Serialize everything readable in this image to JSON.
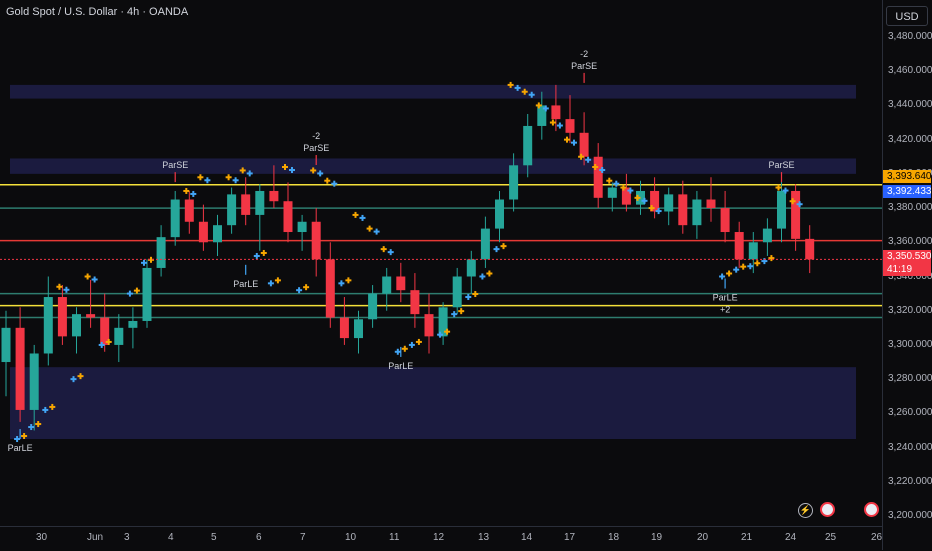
{
  "header": {
    "title": "Gold Spot / U.S. Dollar · 4h · OANDA",
    "currency": "USD"
  },
  "price_axis": {
    "ticks": [
      "3,480.000",
      "3,460.000",
      "3,440.000",
      "3,420.000",
      "3,400.000",
      "3,380.000",
      "3,360.000",
      "3,340.000",
      "3,320.000",
      "3,300.000",
      "3,280.000",
      "3,260.000",
      "3,240.000",
      "3,220.000",
      "3,200.000"
    ],
    "labels": {
      "resistance": "3,393.640",
      "marker": "3,392.433",
      "last_price": "3,350.530",
      "countdown": "41:19"
    }
  },
  "time_axis": {
    "ticks": [
      "30",
      "Jun",
      "3",
      "4",
      "5",
      "6",
      "7",
      "10",
      "11",
      "12",
      "13",
      "14",
      "16",
      "17",
      "18",
      "19",
      "20",
      "21",
      "23",
      "24",
      "25",
      "26"
    ]
  },
  "icons": {
    "bolt": "lightning-icon",
    "flag1": "us-flag-icon",
    "flag2": "us-flag-icon"
  },
  "colors": {
    "up": "#26a69a",
    "down": "#f23645",
    "sar_up": "#42a5f5",
    "sar_down": "#f7a600",
    "level_yellow": "#f5e13a",
    "level_red": "#e53935",
    "zone": "#2a2a6a"
  },
  "chart_data": {
    "type": "candlestick",
    "title": "Gold Spot / U.S. Dollar · 4h · OANDA",
    "ylim": [
      3200,
      3490
    ],
    "grid": false,
    "levels": [
      {
        "price": 3393.64,
        "color": "#f5e13a"
      },
      {
        "price": 3361,
        "color": "#e53935"
      },
      {
        "price": 3323,
        "color": "#f5e13a"
      },
      {
        "price": 3330,
        "color": "#2e7d6f"
      },
      {
        "price": 3380,
        "color": "#2e7d6f"
      },
      {
        "price": 3316,
        "color": "#2e7d6f"
      }
    ],
    "zones": [
      {
        "from": 3444,
        "to": 3452
      },
      {
        "from": 3400,
        "to": 3409
      },
      {
        "from": 3245,
        "to": 3287
      }
    ],
    "candles": [
      [
        3290,
        3320,
        3270,
        3310
      ],
      [
        3310,
        3322,
        3255,
        3262
      ],
      [
        3262,
        3300,
        3250,
        3295
      ],
      [
        3295,
        3340,
        3288,
        3328
      ],
      [
        3328,
        3335,
        3300,
        3305
      ],
      [
        3305,
        3322,
        3295,
        3318
      ],
      [
        3318,
        3338,
        3310,
        3316
      ],
      [
        3316,
        3330,
        3296,
        3300
      ],
      [
        3300,
        3318,
        3290,
        3310
      ],
      [
        3310,
        3322,
        3298,
        3314
      ],
      [
        3314,
        3350,
        3310,
        3345
      ],
      [
        3345,
        3370,
        3340,
        3363
      ],
      [
        3363,
        3390,
        3358,
        3385
      ],
      [
        3385,
        3390,
        3365,
        3372
      ],
      [
        3372,
        3382,
        3355,
        3360
      ],
      [
        3360,
        3376,
        3352,
        3370
      ],
      [
        3370,
        3392,
        3365,
        3388
      ],
      [
        3388,
        3398,
        3370,
        3376
      ],
      [
        3376,
        3394,
        3355,
        3390
      ],
      [
        3390,
        3405,
        3380,
        3384
      ],
      [
        3384,
        3395,
        3360,
        3366
      ],
      [
        3366,
        3376,
        3355,
        3372
      ],
      [
        3372,
        3380,
        3340,
        3350
      ],
      [
        3350,
        3360,
        3310,
        3316
      ],
      [
        3316,
        3328,
        3300,
        3304
      ],
      [
        3304,
        3320,
        3295,
        3315
      ],
      [
        3315,
        3335,
        3310,
        3330
      ],
      [
        3330,
        3345,
        3320,
        3340
      ],
      [
        3340,
        3348,
        3325,
        3332
      ],
      [
        3332,
        3342,
        3310,
        3318
      ],
      [
        3318,
        3330,
        3295,
        3305
      ],
      [
        3305,
        3325,
        3300,
        3322
      ],
      [
        3322,
        3345,
        3318,
        3340
      ],
      [
        3340,
        3355,
        3330,
        3350
      ],
      [
        3350,
        3375,
        3345,
        3368
      ],
      [
        3368,
        3390,
        3360,
        3385
      ],
      [
        3385,
        3412,
        3378,
        3405
      ],
      [
        3405,
        3435,
        3398,
        3428
      ],
      [
        3428,
        3448,
        3420,
        3440
      ],
      [
        3440,
        3452,
        3425,
        3432
      ],
      [
        3432,
        3446,
        3418,
        3424
      ],
      [
        3424,
        3436,
        3405,
        3410
      ],
      [
        3410,
        3418,
        3380,
        3386
      ],
      [
        3386,
        3395,
        3378,
        3392
      ],
      [
        3392,
        3400,
        3378,
        3382
      ],
      [
        3382,
        3396,
        3376,
        3390
      ],
      [
        3390,
        3398,
        3374,
        3378
      ],
      [
        3378,
        3392,
        3370,
        3388
      ],
      [
        3388,
        3396,
        3365,
        3370
      ],
      [
        3370,
        3390,
        3362,
        3385
      ],
      [
        3385,
        3398,
        3372,
        3380
      ],
      [
        3380,
        3390,
        3360,
        3366
      ],
      [
        3366,
        3372,
        3345,
        3350
      ],
      [
        3350,
        3366,
        3342,
        3360
      ],
      [
        3360,
        3374,
        3352,
        3368
      ],
      [
        3368,
        3396,
        3360,
        3390
      ],
      [
        3390,
        3394,
        3355,
        3362
      ],
      [
        3362,
        3370,
        3342,
        3350
      ]
    ],
    "sar_down": [
      [
        3334,
        4,
        0
      ],
      [
        3340,
        6,
        0
      ],
      [
        3390,
        13,
        0
      ],
      [
        3398,
        14,
        0
      ],
      [
        3398,
        16,
        0
      ],
      [
        3402,
        17,
        0
      ],
      [
        3404,
        20,
        0
      ],
      [
        3402,
        22,
        0
      ],
      [
        3396,
        23,
        0
      ],
      [
        3376,
        25,
        0
      ],
      [
        3368,
        26,
        0
      ],
      [
        3356,
        27,
        0
      ],
      [
        3452,
        36,
        0
      ],
      [
        3448,
        37,
        0
      ],
      [
        3440,
        38,
        0
      ],
      [
        3430,
        39,
        0
      ],
      [
        3420,
        40,
        0
      ],
      [
        3410,
        41,
        0
      ],
      [
        3404,
        42,
        0
      ],
      [
        3396,
        43,
        0
      ],
      [
        3392,
        44,
        0
      ],
      [
        3386,
        45,
        0
      ],
      [
        3380,
        46,
        0
      ],
      [
        3392,
        55,
        0
      ],
      [
        3384,
        56,
        0
      ]
    ],
    "sar_up": [
      [
        3245,
        1,
        0
      ],
      [
        3252,
        2,
        0
      ],
      [
        3262,
        3,
        0
      ],
      [
        3280,
        5,
        0
      ],
      [
        3300,
        7,
        0
      ],
      [
        3330,
        9,
        0
      ],
      [
        3348,
        10,
        0
      ],
      [
        3352,
        18,
        0
      ],
      [
        3336,
        19,
        0
      ],
      [
        3332,
        21,
        0
      ],
      [
        3336,
        24,
        0
      ],
      [
        3296,
        28,
        0
      ],
      [
        3300,
        29,
        0
      ],
      [
        3306,
        31,
        0
      ],
      [
        3318,
        32,
        0
      ],
      [
        3328,
        33,
        0
      ],
      [
        3340,
        34,
        0
      ],
      [
        3356,
        35,
        0
      ],
      [
        3340,
        51,
        0
      ],
      [
        3344,
        52,
        0
      ],
      [
        3346,
        53,
        0
      ],
      [
        3349,
        54,
        0
      ]
    ],
    "annotations": [
      {
        "text": "ParLE",
        "x": 1,
        "price": 3252,
        "pos": "below"
      },
      {
        "text": "ParSE",
        "x": 12,
        "price": 3394,
        "pos": "above"
      },
      {
        "text": "ParLE",
        "x": 17,
        "price": 3348,
        "pos": "below"
      },
      {
        "text": "ParSE",
        "x": 22,
        "price": 3404,
        "pos": "above"
      },
      {
        "text": "-2",
        "x": 22,
        "price": 3404,
        "pos": "above2"
      },
      {
        "text": "ParLE",
        "x": 28,
        "price": 3300,
        "pos": "below"
      },
      {
        "text": "ParSE",
        "x": 41,
        "price": 3452,
        "pos": "above"
      },
      {
        "text": "-2",
        "x": 41,
        "price": 3452,
        "pos": "above2"
      },
      {
        "text": "ParLE",
        "x": 51,
        "price": 3340,
        "pos": "below"
      },
      {
        "text": "+2",
        "x": 51,
        "price": 3340,
        "pos": "below2"
      },
      {
        "text": "ParSE",
        "x": 55,
        "price": 3394,
        "pos": "above"
      }
    ]
  }
}
